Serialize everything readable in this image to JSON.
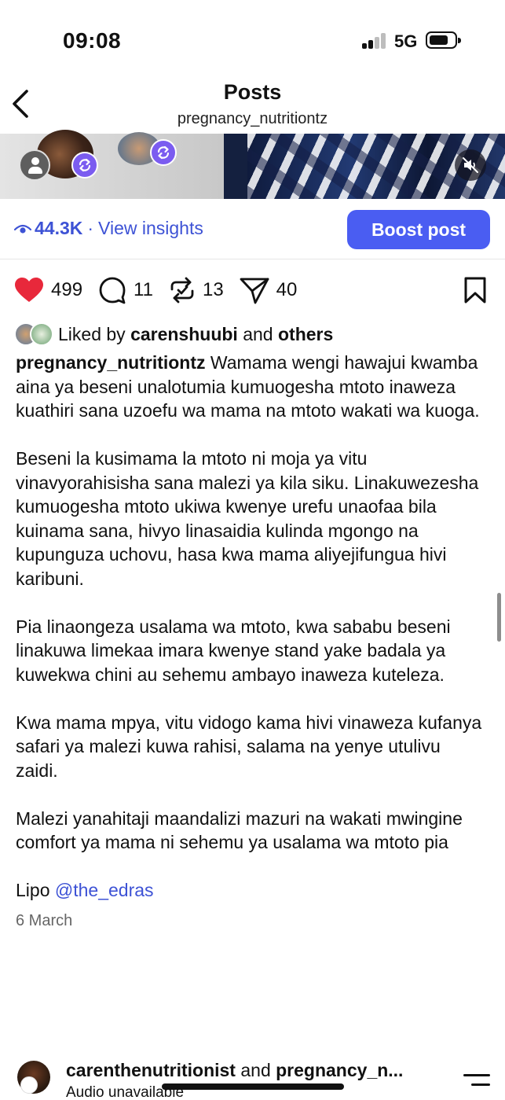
{
  "status_bar": {
    "time": "09:08",
    "network": "5G"
  },
  "header": {
    "title": "Posts",
    "username": "pregnancy_nutritiontz",
    "back_icon": "chevron-left-icon"
  },
  "media": {
    "mute_icon": "speaker-muted-icon",
    "collab_icon": "repost-icon"
  },
  "insights": {
    "icon": "eye-icon",
    "views": "44.3K",
    "separator": "·",
    "link_label": "View insights",
    "boost_label": "Boost post",
    "accent_color": "#4a5df2"
  },
  "actions": {
    "likes": "499",
    "comments": "11",
    "reposts": "13",
    "shares": "40",
    "like_icon": "heart-filled-icon",
    "comment_icon": "comment-icon",
    "repost_icon": "repost-icon",
    "share_icon": "send-icon",
    "save_icon": "bookmark-icon",
    "like_color": "#e8283b"
  },
  "liked_by": {
    "prefix": "Liked by",
    "user": "carenshuubi",
    "middle": "and",
    "suffix": "others"
  },
  "caption": {
    "author": "pregnancy_nutritiontz",
    "p1": "Wamama wengi hawajui kwamba aina ya beseni unalotumia kumuogesha mtoto inaweza kuathiri sana uzoefu wa mama na mtoto wakati wa kuoga.",
    "p2": "Beseni la kusimama la mtoto ni moja ya vitu vinavyorahisisha sana malezi ya kila siku. Linakuwezesha kumuogesha mtoto ukiwa kwenye urefu unaofaa bila kuinama sana, hivyo linasaidia kulinda mgongo na kupunguza uchovu, hasa kwa mama aliyejifungua hivi karibuni.",
    "p3": "Pia linaongeza usalama wa mtoto, kwa sababu beseni linakuwa limekaa imara kwenye stand yake badala ya kuwekwa chini au sehemu ambayo inaweza kuteleza.",
    "p4": "Kwa mama mpya, vitu vidogo kama hivi vinaweza kufanya safari ya malezi kuwa rahisi, salama na yenye utulivu zaidi.",
    "p5": "Malezi yanahitaji maandalizi mazuri na wakati mwingine comfort ya mama ni sehemu ya usalama wa mtoto pia",
    "lipo_prefix": "Lipo",
    "mention": "@the_edras",
    "date": "6 March"
  },
  "next_post": {
    "user1": "carenthenutritionist",
    "and": "and",
    "user2": "pregnancy_n...",
    "audio": "Audio unavailable",
    "menu_icon": "menu-icon"
  }
}
